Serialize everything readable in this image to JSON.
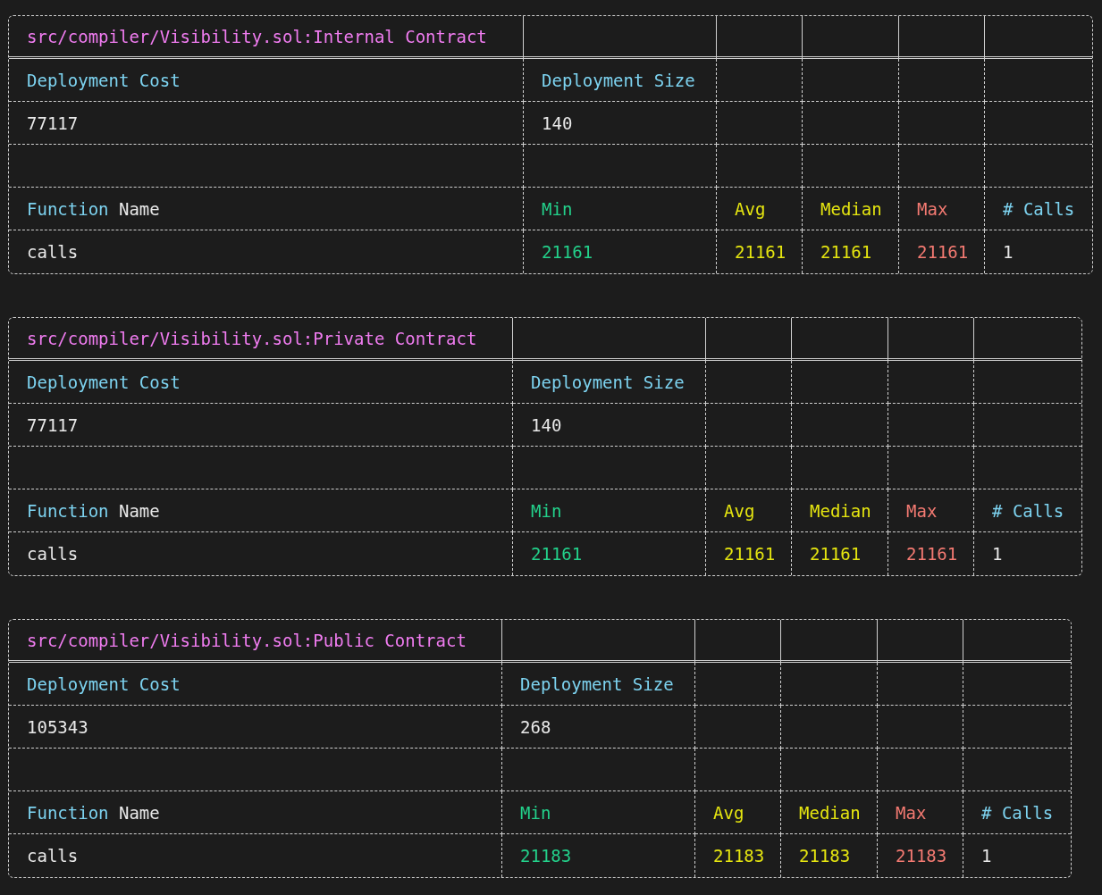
{
  "tables": [
    {
      "title": "src/compiler/Visibility.sol:Internal Contract",
      "deployment": {
        "cost_label": "Deployment Cost",
        "size_label": "Deployment Size",
        "cost": "77117",
        "size": "140"
      },
      "function_header": {
        "keyword": "Function",
        "rest": "Name"
      },
      "columns": [
        {
          "header": "Min",
          "color": "#23d18b"
        },
        {
          "header": "Avg",
          "color": "#e5e510"
        },
        {
          "header": "Median",
          "color": "#e5e510"
        },
        {
          "header": "Max",
          "color": "#f47a72"
        },
        {
          "header": "# Calls",
          "color": "#7dd3f0"
        }
      ],
      "functions": [
        {
          "name": "calls",
          "values": [
            {
              "text": "21161",
              "color": "#23d18b"
            },
            {
              "text": "21161",
              "color": "#e5e510"
            },
            {
              "text": "21161",
              "color": "#e5e510"
            },
            {
              "text": "21161",
              "color": "#f47a72"
            },
            {
              "text": "1",
              "color": "#e8e8e8"
            }
          ]
        }
      ]
    },
    {
      "title": "src/compiler/Visibility.sol:Private Contract",
      "deployment": {
        "cost_label": "Deployment Cost",
        "size_label": "Deployment Size",
        "cost": "77117",
        "size": "140"
      },
      "function_header": {
        "keyword": "Function",
        "rest": "Name"
      },
      "columns": [
        {
          "header": "Min",
          "color": "#23d18b"
        },
        {
          "header": "Avg",
          "color": "#e5e510"
        },
        {
          "header": "Median",
          "color": "#e5e510"
        },
        {
          "header": "Max",
          "color": "#f47a72"
        },
        {
          "header": "# Calls",
          "color": "#7dd3f0"
        }
      ],
      "functions": [
        {
          "name": "calls",
          "values": [
            {
              "text": "21161",
              "color": "#23d18b"
            },
            {
              "text": "21161",
              "color": "#e5e510"
            },
            {
              "text": "21161",
              "color": "#e5e510"
            },
            {
              "text": "21161",
              "color": "#f47a72"
            },
            {
              "text": "1",
              "color": "#e8e8e8"
            }
          ]
        }
      ]
    },
    {
      "title": "src/compiler/Visibility.sol:Public Contract",
      "deployment": {
        "cost_label": "Deployment Cost",
        "size_label": "Deployment Size",
        "cost": "105343",
        "size": "268"
      },
      "function_header": {
        "keyword": "Function",
        "rest": "Name"
      },
      "columns": [
        {
          "header": "Min",
          "color": "#23d18b"
        },
        {
          "header": "Avg",
          "color": "#e5e510"
        },
        {
          "header": "Median",
          "color": "#e5e510"
        },
        {
          "header": "Max",
          "color": "#f47a72"
        },
        {
          "header": "# Calls",
          "color": "#7dd3f0"
        }
      ],
      "functions": [
        {
          "name": "calls",
          "values": [
            {
              "text": "21183",
              "color": "#23d18b"
            },
            {
              "text": "21183",
              "color": "#e5e510"
            },
            {
              "text": "21183",
              "color": "#e5e510"
            },
            {
              "text": "21183",
              "color": "#f47a72"
            },
            {
              "text": "1",
              "color": "#e8e8e8"
            }
          ]
        }
      ]
    }
  ]
}
